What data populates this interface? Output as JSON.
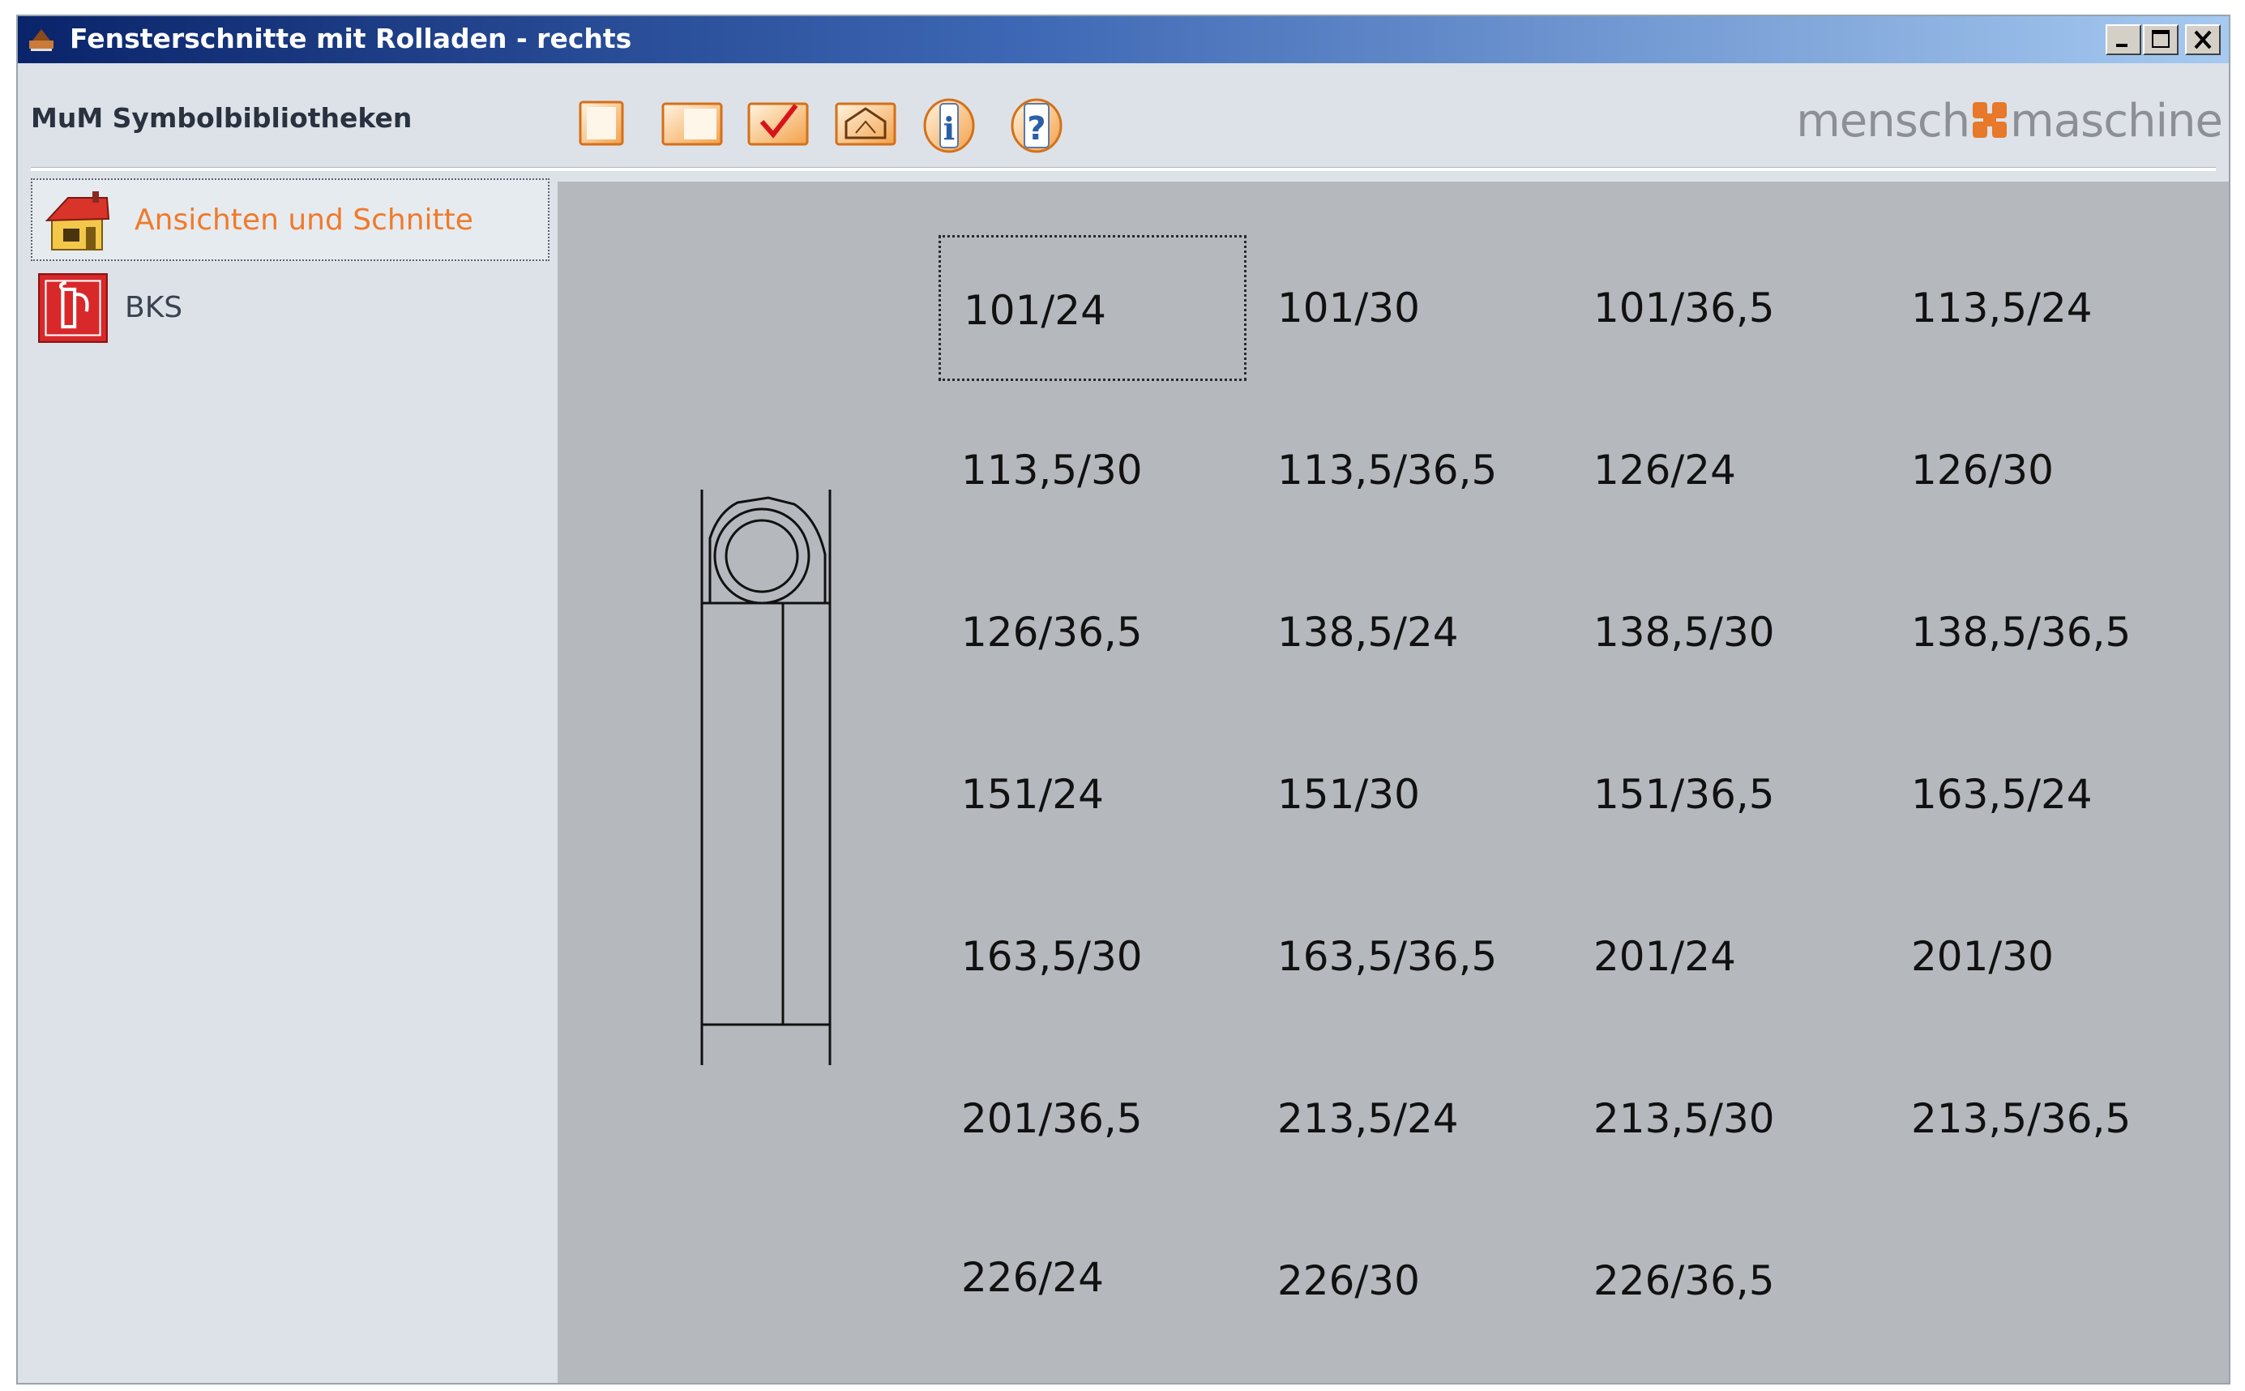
{
  "window": {
    "title": "Fensterschnitte mit Rolladen - rechts",
    "accent": "#0a246a",
    "controls": [
      "minimize-icon",
      "maximize-icon",
      "close-icon"
    ]
  },
  "toolbar": {
    "label": "MuM Symbolbibliotheken",
    "buttons": [
      {
        "icon": "blank-page-icon"
      },
      {
        "icon": "split-panel-icon"
      },
      {
        "icon": "checkmark-icon"
      },
      {
        "icon": "roof-shape-icon"
      },
      {
        "icon": "info-icon"
      },
      {
        "icon": "help-icon"
      }
    ],
    "brand_left": "mensch",
    "brand_right": "maschine",
    "brand_accent": "#e8782a"
  },
  "sidebar": {
    "items": [
      {
        "label": "Ansichten und Schnitte",
        "icon": "house-icon",
        "selected": true,
        "color": "#f07a2a"
      },
      {
        "label": "BKS",
        "icon": "fire-extinguisher-sign-icon",
        "selected": false
      }
    ]
  },
  "grid": {
    "selected": "101/24",
    "items": [
      "101/24",
      "101/30",
      "101/36,5",
      "113,5/24",
      "113,5/30",
      "113,5/36,5",
      "126/24",
      "126/30",
      "126/36,5",
      "138,5/24",
      "138,5/30",
      "138,5/36,5",
      "151/24",
      "151/30",
      "151/36,5",
      "163,5/24",
      "163,5/30",
      "163,5/36,5",
      "201/24",
      "201/30",
      "201/36,5",
      "213,5/24",
      "213,5/30",
      "213,5/36,5",
      "226/24",
      "226/30",
      "226/36,5"
    ]
  }
}
